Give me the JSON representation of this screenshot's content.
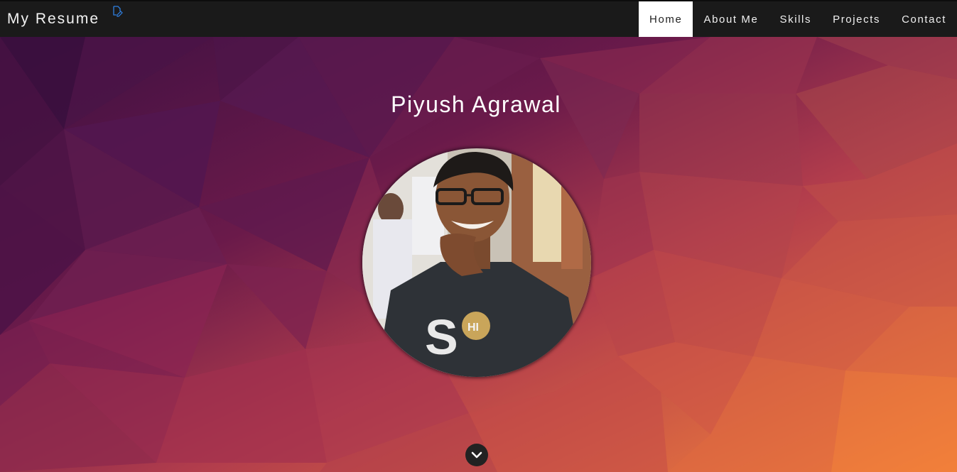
{
  "header": {
    "brand": "My Resume",
    "edit_icon": "edit-document-icon"
  },
  "nav": {
    "items": [
      {
        "label": "Home",
        "active": true
      },
      {
        "label": "About Me",
        "active": false
      },
      {
        "label": "Skills",
        "active": false
      },
      {
        "label": "Projects",
        "active": false
      },
      {
        "label": "Contact",
        "active": false
      }
    ]
  },
  "hero": {
    "name": "Piyush Agrawal",
    "avatar_alt": "profile-photo",
    "scroll_icon": "chevron-down-icon"
  },
  "colors": {
    "navbar_bg": "#1a1a1a",
    "active_nav_bg": "#ffffff",
    "bg_gradient_start": "#4a1445",
    "bg_gradient_mid": "#a83250",
    "bg_gradient_end": "#f07a3c"
  }
}
